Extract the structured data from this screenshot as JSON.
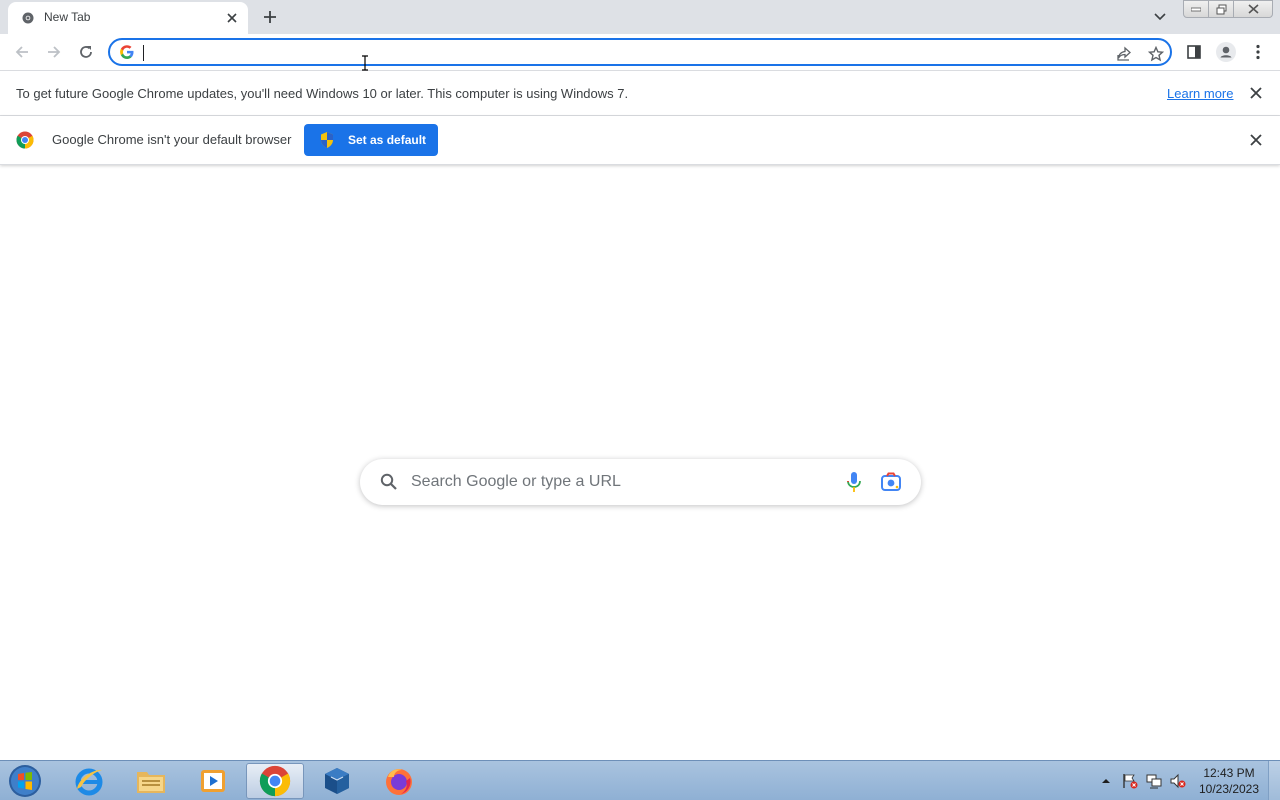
{
  "tab": {
    "title": "New Tab"
  },
  "omnibox": {
    "value": "",
    "placeholder": ""
  },
  "infobar_update": {
    "message": "To get future Google Chrome updates, you'll need Windows 10 or later. This computer is using Windows 7.",
    "link": "Learn more"
  },
  "infobar_default": {
    "message": "Google Chrome isn't your default browser",
    "button": "Set as default"
  },
  "ntp": {
    "search_placeholder": "Search Google or type a URL"
  },
  "taskbar": {
    "apps": [
      "start-orb",
      "internet-explorer",
      "file-explorer",
      "media-player",
      "google-chrome",
      "virtualbox",
      "firefox"
    ],
    "active_app": "google-chrome",
    "clock": {
      "time": "12:43 PM",
      "date": "10/23/2023"
    }
  },
  "colors": {
    "accent": "#1a73e8",
    "tabstrip": "#dee1e6",
    "taskbar": "#9fbbd9"
  }
}
